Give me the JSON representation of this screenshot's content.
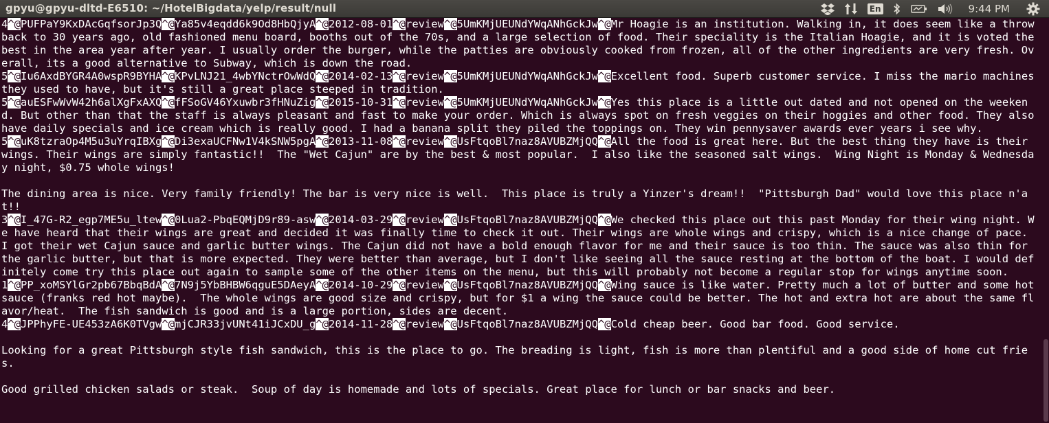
{
  "window": {
    "title": "gpyu@gpyu-dltd-E6510: ~/HotelBigdata/yelp/result/null"
  },
  "indicators": {
    "dropbox_icon": "dropbox-icon",
    "transfer_icon": "network-transfer-icon",
    "keyboard_layout": "En",
    "bluetooth_icon": "bluetooth-icon",
    "battery_icon": "battery-icon",
    "volume_icon": "volume-icon",
    "clock": "9:44 PM",
    "settings_icon": "gear-icon"
  },
  "terminal": {
    "control_marker": "^@",
    "lines": [
      "4^@PUFPaY9KxDAcGqfsorJp3Q^@Ya85v4eqdd6k9Od8HbQjyA^@2012-08-01^@review^@5UmKMjUEUNdYWqANhGckJw^@Mr Hoagie is an institution. Walking in, it does seem like a throwback to 30 years ago, old fashioned menu board, booths out of the 70s, and a large selection of food. Their speciality is the Italian Hoagie, and it is voted the best in the area year after year. I usually order the burger, while the patties are obviously cooked from frozen, all of the other ingredients are very fresh. Overall, its a good alternative to Subway, which is down the road.",
      "5^@Iu6AxdBYGR4A0wspR9BYHA^@KPvLNJ21_4wbYNctrOwWdQ^@2014-02-13^@review^@5UmKMjUEUNdYWqANhGckJw^@Excellent food. Superb customer service. I miss the mario machines they used to have, but it's still a great place steeped in tradition.",
      "5^@auESFwWvW42h6alXgFxAXQ^@fFSoGV46Yxuwbr3fHNuZig^@2015-10-31^@review^@5UmKMjUEUNdYWqANhGckJw^@Yes this place is a little out dated and not opened on the weekend. But other than that the staff is always pleasant and fast to make your order. Which is always spot on fresh veggies on their hoggies and other food. They also have daily specials and ice cream which is really good. I had a banana split they piled the toppings on. They win pennysaver awards ever years i see why.",
      "5^@uK8tzraOp4M5u3uYrqIBXg^@Di3exaUCFNw1V4kSNW5pgA^@2013-11-08^@review^@UsFtqoBl7naz8AVUBZMjQQ^@All the food is great here. But the best thing they have is their wings. Their wings are simply fantastic!!  The \"Wet Cajun\" are by the best & most popular.  I also like the seasoned salt wings.  Wing Night is Monday & Wednesday night, $0.75 whole wings!",
      "",
      "The dining area is nice. Very family friendly! The bar is very nice is well.  This place is truly a Yinzer's dream!!  \"Pittsburgh Dad\" would love this place n'at!!",
      "3^@I_47G-R2_egp7ME5u_ltew^@0Lua2-PbqEQMjD9r89-asw^@2014-03-29^@review^@UsFtqoBl7naz8AVUBZMjQQ^@We checked this place out this past Monday for their wing night. We have heard that their wings are great and decided it was finally time to check it out. Their wings are whole wings and crispy, which is a nice change of pace. I got their wet Cajun sauce and garlic butter wings. The Cajun did not have a bold enough flavor for me and their sauce is too thin. The sauce was also thin for the garlic butter, but that is more expected. They were better than average, but I don't like seeing all the sauce resting at the bottom of the boat. I would definitely come try this place out again to sample some of the other items on the menu, but this will probably not become a regular stop for wings anytime soon.",
      "1^@PP_xoMSYlGr2pb67BbqBdA^@7N9j5YbBHBW6qguE5DAeyA^@2014-10-29^@review^@UsFtqoBl7naz8AVUBZMjQQ^@Wing sauce is like water. Pretty much a lot of butter and some hot sauce (franks red hot maybe).  The whole wings are good size and crispy, but for $1 a wing the sauce could be better. The hot and extra hot are about the same flavor/heat.  The fish sandwich is good and is a large portion, sides are decent.",
      "4^@JPPhyFE-UE453zA6K0TVgw^@mjCJR33jvUNt41iJCxDU_g^@2014-11-28^@review^@UsFtqoBl7naz8AVUBZMjQQ^@Cold cheap beer. Good bar food. Good service.",
      "",
      "Looking for a great Pittsburgh style fish sandwich, this is the place to go. The breading is light, fish is more than plentiful and a good side of home cut fries.",
      "",
      "Good grilled chicken salads or steak.  Soup of day is homemade and lots of specials. Great place for lunch or bar snacks and beer."
    ]
  }
}
